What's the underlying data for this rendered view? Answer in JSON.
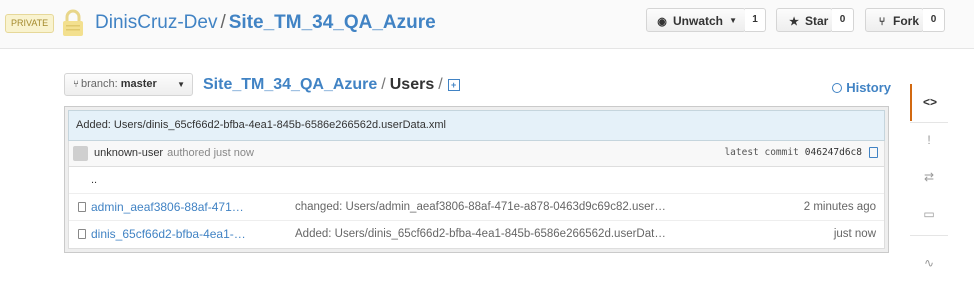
{
  "header": {
    "badge": "PRIVATE",
    "owner": "DinisCruz-Dev",
    "separator": "/",
    "repo": "Site_TM_34_QA_Azure",
    "watch": {
      "label": "Unwatch",
      "count": "1"
    },
    "star": {
      "label": "Star",
      "count": "0"
    },
    "fork": {
      "label": "Fork",
      "count": "0"
    }
  },
  "toolbar": {
    "branch_label": "branch:",
    "branch_value": "master",
    "crumb_repo": "Site_TM_34_QA_Azure",
    "crumb_sep": "/",
    "crumb_dir": "Users",
    "crumb_trailing": "/",
    "history_label": "History"
  },
  "latest_commit": {
    "message": "Added: Users/dinis_65cf66d2-bfba-4ea1-845b-6586e266562d.userData.xml",
    "author": "unknown-user",
    "authored": "authored just now",
    "label": "latest commit",
    "sha": "046247d6c8"
  },
  "files": {
    "parent": "..",
    "rows": [
      {
        "name": "admin_aeaf3806-88af-471…",
        "message": "changed: Users/admin_aeaf3806-88af-471e-a878-0463d9c69c82.user…",
        "age": "2 minutes ago"
      },
      {
        "name": "dinis_65cf66d2-bfba-4ea1-…",
        "message": "Added: Users/dinis_65cf66d2-bfba-4ea1-845b-6586e266562d.userDat…",
        "age": "just now"
      }
    ]
  },
  "sidebar": {
    "items": [
      {
        "name": "code-icon",
        "glyph": "<>"
      },
      {
        "name": "issues-icon",
        "glyph": "!"
      },
      {
        "name": "pull-requests-icon",
        "glyph": "⇄"
      },
      {
        "name": "wiki-icon",
        "glyph": "▭"
      },
      {
        "name": "pulse-icon",
        "glyph": "∿"
      }
    ]
  },
  "colors": {
    "link": "#4183c4",
    "commit_bar": "#e5f1f9",
    "active_tab": "#d26911"
  }
}
